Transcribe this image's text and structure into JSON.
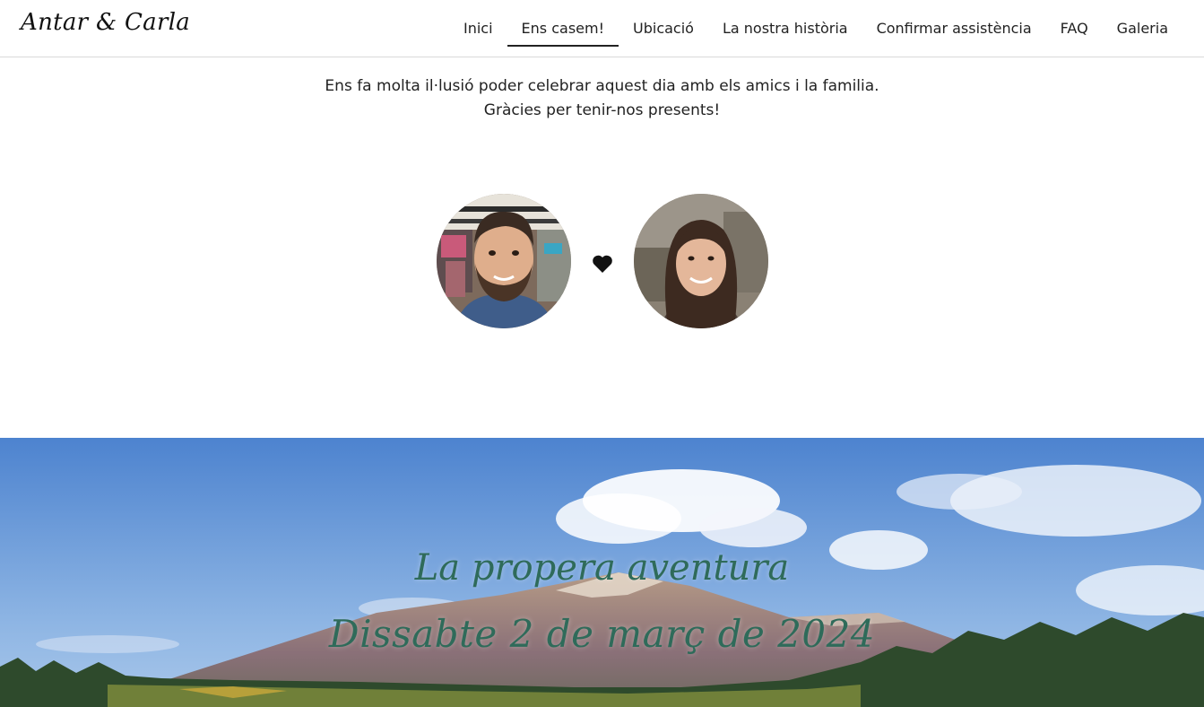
{
  "header": {
    "brand": "Antar & Carla",
    "nav": [
      {
        "label": "Inici",
        "active": false
      },
      {
        "label": "Ens casem!",
        "active": true
      },
      {
        "label": "Ubicació",
        "active": false
      },
      {
        "label": "La nostra història",
        "active": false
      },
      {
        "label": "Confirmar assistència",
        "active": false
      },
      {
        "label": "FAQ",
        "active": false
      },
      {
        "label": "Galeria",
        "active": false
      }
    ]
  },
  "welcome": {
    "line1": "Ens fa molta il·lusió poder celebrar aquest dia amb els amics i la familia.",
    "line2": "Gràcies per tenir-nos presents!"
  },
  "couple": {
    "left_photo": "groom-photo",
    "separator_icon": "heart-icon",
    "right_photo": "bride-photo"
  },
  "hero": {
    "title": "La propera aventura",
    "date": "Dissabte 2 de març de 2024"
  },
  "colors": {
    "hero_text": "#2f6b5a",
    "sky_top": "#4d83cf",
    "sky_bottom": "#a9c7ea",
    "nav_underline": "#222222"
  }
}
